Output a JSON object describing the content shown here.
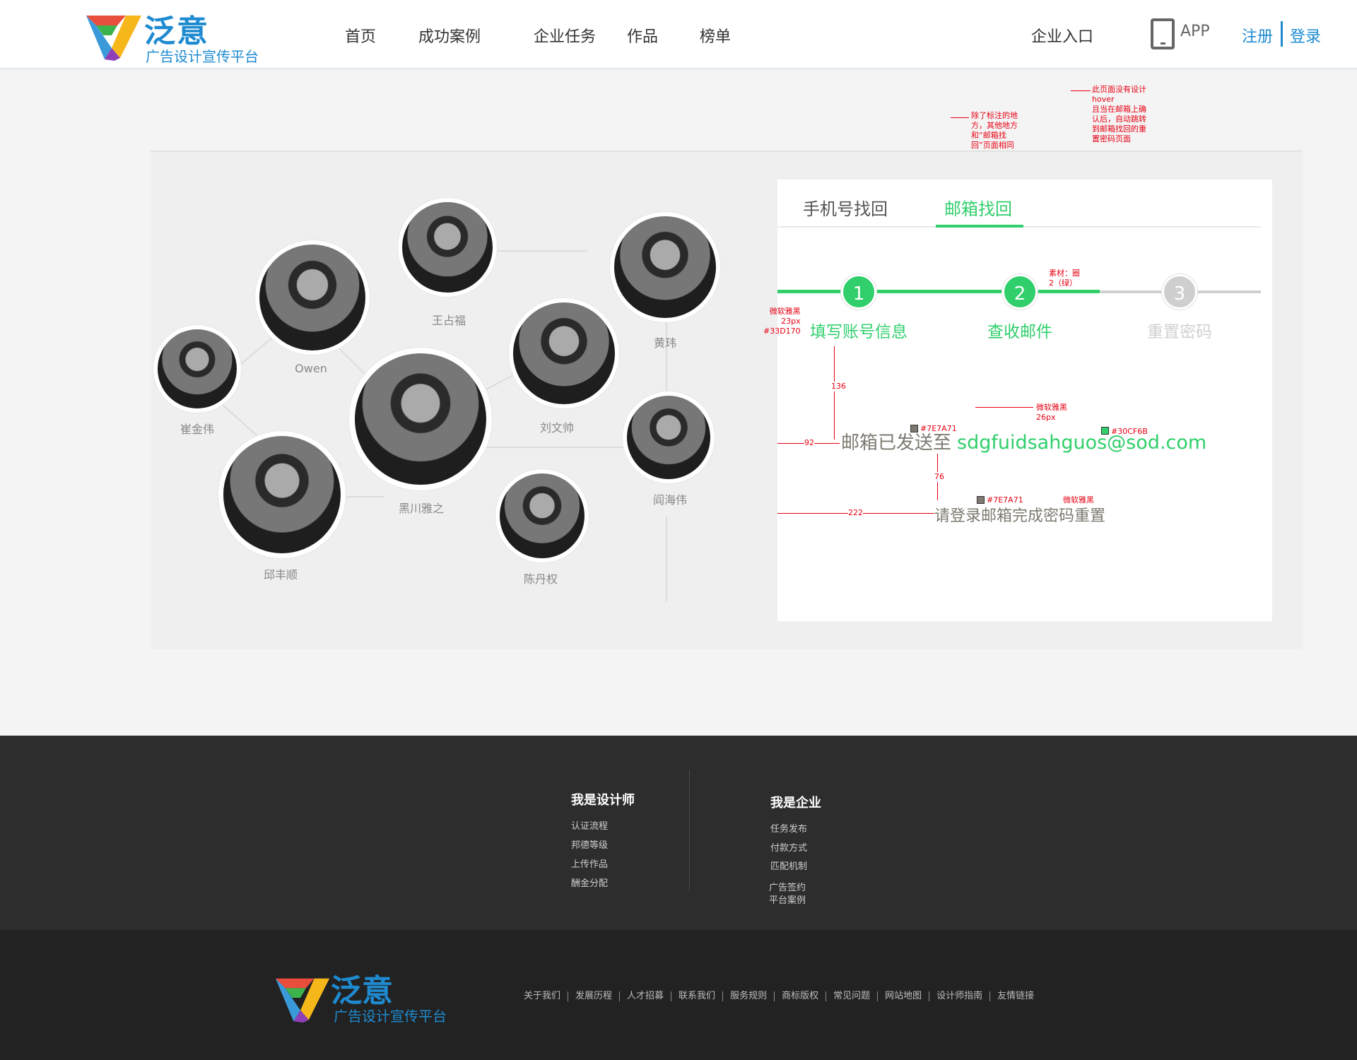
{
  "header": {
    "logo_name": "泛意",
    "logo_slogan": "广告设计宣传平台",
    "nav": [
      "首页",
      "成功案例",
      "企业任务",
      "作品",
      "榜单"
    ],
    "enterprise_entry": "企业入口",
    "app_label": "APP",
    "register": "注册",
    "login": "登录",
    "brand_color": "#1e8bd1"
  },
  "designers": [
    {
      "name": "王占福"
    },
    {
      "name": "黄玮"
    },
    {
      "name": "Owen"
    },
    {
      "name": "崔金伟"
    },
    {
      "name": "刘文帅"
    },
    {
      "name": "黑川雅之"
    },
    {
      "name": "阎海伟"
    },
    {
      "name": "邱丰顺"
    },
    {
      "name": "陈丹权"
    }
  ],
  "recovery": {
    "tabs": [
      "手机号找回",
      "邮箱找回"
    ],
    "active_tab": "邮箱找回",
    "steps": [
      {
        "number": "1",
        "label": "填写账号信息",
        "state": "done"
      },
      {
        "number": "2",
        "label": "查收邮件",
        "state": "active"
      },
      {
        "number": "3",
        "label": "重置密码",
        "state": "pending"
      }
    ],
    "sent_prefix": "邮箱已发送至",
    "email": "sdgfuidsahguos@sod.com",
    "login_hint": "请登录邮箱完成密码重置",
    "accent_color": "#30cf6b",
    "text_color": "#7e7a71"
  },
  "annotations": {
    "note_hover": "此页面没有设计\nhover\n且当在邮箱上确\n认后，自动跳转\n到邮箱找回的重\n置密码页面",
    "note_same": "除了标注的地\n方，其他地方\n和“邮箱找\n回”页面相同",
    "step_material": "素材：圈\n2（绿）",
    "step_font": "微软雅黑\n23px\n#33D170",
    "gap_136": "136",
    "gap_92": "92",
    "gap_76": "76",
    "gap_222": "222",
    "color_sent": "#7E7A71",
    "font_email": "微软雅黑\n26px",
    "color_email": "#30CF6B",
    "color_hint": "#7E7A71",
    "font_hint": "微软雅黑"
  },
  "footer": {
    "designer_title": "我是设计师",
    "designer_links": [
      "认证流程",
      "邦德等级",
      "上传作品",
      "酬金分配"
    ],
    "enterprise_title": "我是企业",
    "enterprise_links": [
      "任务发布",
      "付款方式",
      "匹配机制",
      "广告签约",
      "平台案例"
    ],
    "bottom_links": [
      "关于我们",
      "发展历程",
      "人才招募",
      "联系我们",
      "服务规则",
      "商标版权",
      "常见问题",
      "网站地图",
      "设计师指南",
      "友情链接"
    ]
  }
}
